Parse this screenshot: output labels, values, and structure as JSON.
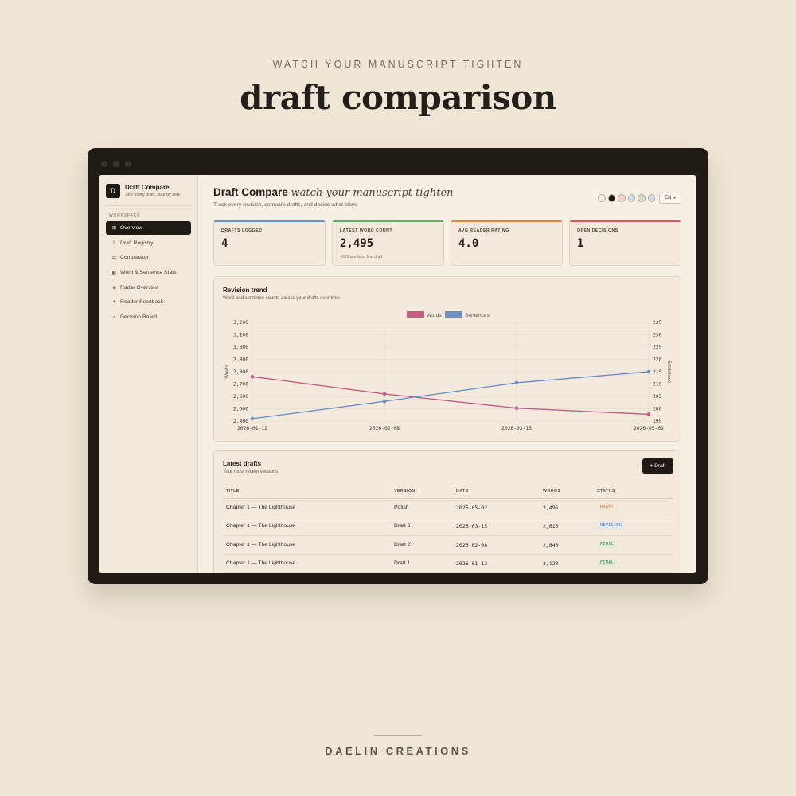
{
  "page": {
    "kicker": "WATCH YOUR MANUSCRIPT TIGHTEN",
    "title": "draft comparison",
    "footer": "DAELIN CREATIONS"
  },
  "sidebar": {
    "brand_initial": "D",
    "brand_name": "Draft Compare",
    "brand_tagline": "See every draft, side by side",
    "section_label": "WORKSPACE",
    "items": [
      {
        "icon": "grid-icon",
        "glyph": "⊞",
        "label": "Overview",
        "active": true
      },
      {
        "icon": "registry-icon",
        "glyph": "≡",
        "label": "Draft Registry",
        "active": false
      },
      {
        "icon": "compare-icon",
        "glyph": "⇄",
        "label": "Comparator",
        "active": false
      },
      {
        "icon": "stats-icon",
        "glyph": "◧",
        "label": "Word & Sentence Stats",
        "active": false
      },
      {
        "icon": "radar-icon",
        "glyph": "◈",
        "label": "Radar Overview",
        "active": false
      },
      {
        "icon": "feedback-icon",
        "glyph": "✦",
        "label": "Reader Feedback",
        "active": false
      },
      {
        "icon": "check-icon",
        "glyph": "✓",
        "label": "Decision Board",
        "active": false
      }
    ]
  },
  "header": {
    "title": "Draft Compare",
    "title_em": "watch your manuscript tighten",
    "subtitle": "Track every revision, compare drafts, and decide what stays.",
    "swatches": [
      "#f3ecdf",
      "#1f1a14",
      "#f4d3c8",
      "#cfe0ea",
      "#cfe0c4",
      "#d4d7ea"
    ],
    "language": "EN"
  },
  "stats": [
    {
      "label": "DRAFTS LOGGED",
      "value": "4",
      "note": "",
      "color": "#6f8fc4"
    },
    {
      "label": "LATEST WORD COUNT",
      "value": "2,495",
      "note": "−625 words vs first draft",
      "color": "#6aa86f"
    },
    {
      "label": "AVG READER RATING",
      "value": "4.0",
      "note": "",
      "color": "#d9874a"
    },
    {
      "label": "OPEN DECISIONS",
      "value": "1",
      "note": "",
      "color": "#cf5c5c"
    }
  ],
  "trend": {
    "title": "Revision trend",
    "subtitle": "Word and sentence counts across your drafts over time"
  },
  "chart_data": {
    "type": "line",
    "x": [
      "2026-01-12",
      "2026-02-08",
      "2026-03-15",
      "2026-05-02"
    ],
    "series": [
      {
        "name": "Words",
        "axis": "left",
        "color": "#c25e86",
        "values": [
          2760,
          2620,
          2505,
          2455
        ]
      },
      {
        "name": "Sentences",
        "axis": "right",
        "color": "#6f8fc4",
        "values": [
          196,
          203,
          210.5,
          215
        ]
      }
    ],
    "ylabel": "Words",
    "ylabel_right": "Sentences",
    "ylim": [
      2400,
      3200
    ],
    "ylim_right": [
      195,
      235
    ],
    "yticks": [
      "3,200",
      "3,100",
      "3,000",
      "2,900",
      "2,800",
      "2,700",
      "2,600",
      "2,500",
      "2,400"
    ],
    "yticks_right": [
      "235",
      "230",
      "225",
      "220",
      "215",
      "210",
      "205",
      "200",
      "195"
    ],
    "legend_position": "top-center",
    "grid": true
  },
  "drafts": {
    "title": "Latest drafts",
    "subtitle": "Your most recent versions",
    "add_label": "+ Draft",
    "columns": [
      "TITLE",
      "VERSION",
      "DATE",
      "WORDS",
      "STATUS"
    ],
    "rows": [
      {
        "title": "Chapter 1 — The Lighthouse",
        "version": "Polish",
        "date": "2026-05-02",
        "words": "2,495",
        "status": "DRAFT",
        "status_color": "#c9772f",
        "status_bg": "#f3e6d3"
      },
      {
        "title": "Chapter 1 — The Lighthouse",
        "version": "Draft 3",
        "date": "2026-03-15",
        "words": "2,610",
        "status": "REVISING",
        "status_color": "#4f78b5",
        "status_bg": "#e2e8ef"
      },
      {
        "title": "Chapter 1 — The Lighthouse",
        "version": "Draft 2",
        "date": "2026-02-08",
        "words": "2,840",
        "status": "FINAL",
        "status_color": "#3e8d53",
        "status_bg": "#e3ecda"
      },
      {
        "title": "Chapter 1 — The Lighthouse",
        "version": "Draft 1",
        "date": "2026-01-12",
        "words": "3,120",
        "status": "FINAL",
        "status_color": "#3e8d53",
        "status_bg": "#e3ecda"
      }
    ]
  }
}
